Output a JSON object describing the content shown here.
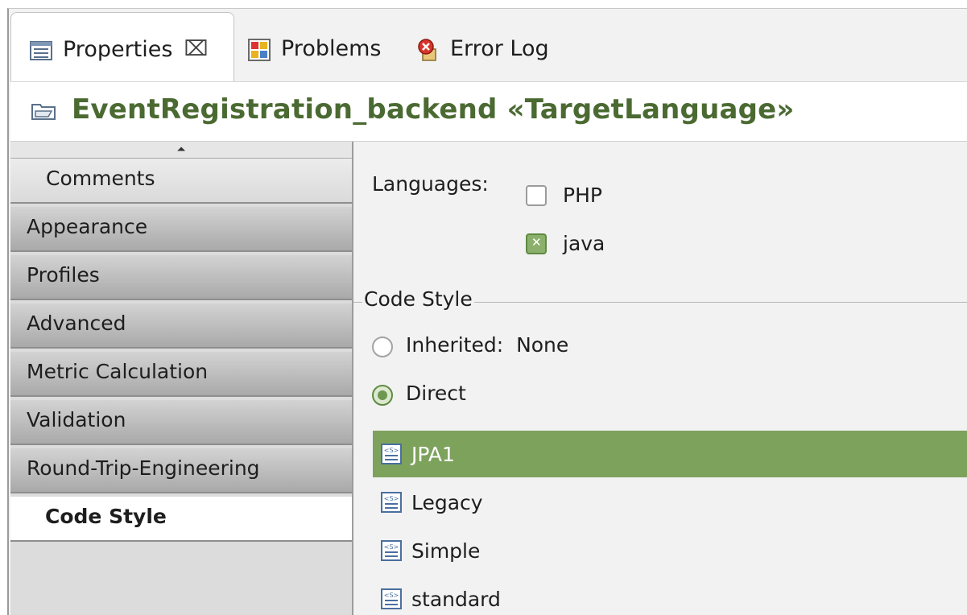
{
  "tabs": {
    "properties": "Properties",
    "properties_close": "⌧",
    "problems": "Problems",
    "error_log": "Error Log"
  },
  "title": "EventRegistration_backend «TargetLanguage»",
  "sidebar": {
    "scroll_up": "⏶",
    "items": [
      {
        "label": "Comments"
      },
      {
        "label": "Appearance"
      },
      {
        "label": "Profiles"
      },
      {
        "label": "Advanced"
      },
      {
        "label": "Metric Calculation"
      },
      {
        "label": "Validation"
      },
      {
        "label": "Round-Trip-Engineering"
      },
      {
        "label": "Code Style",
        "selected": true
      }
    ]
  },
  "content": {
    "languages_label": "Languages:",
    "languages": [
      {
        "name": "PHP",
        "checked": false
      },
      {
        "name": "java",
        "checked": true
      }
    ],
    "code_style_group": "Code Style",
    "inherited_label": "Inherited:",
    "inherited_value": "None",
    "direct_label": "Direct",
    "direct_selected": true,
    "styles": [
      {
        "name": "JPA1",
        "selected": true
      },
      {
        "name": "Legacy"
      },
      {
        "name": "Simple"
      },
      {
        "name": "standard"
      }
    ]
  },
  "colors": {
    "accent": "#7da25c",
    "title_text": "#4a6a32"
  },
  "icons": [
    "properties-icon",
    "problems-icon",
    "error-log-icon",
    "folder-icon",
    "code-style-icon"
  ]
}
